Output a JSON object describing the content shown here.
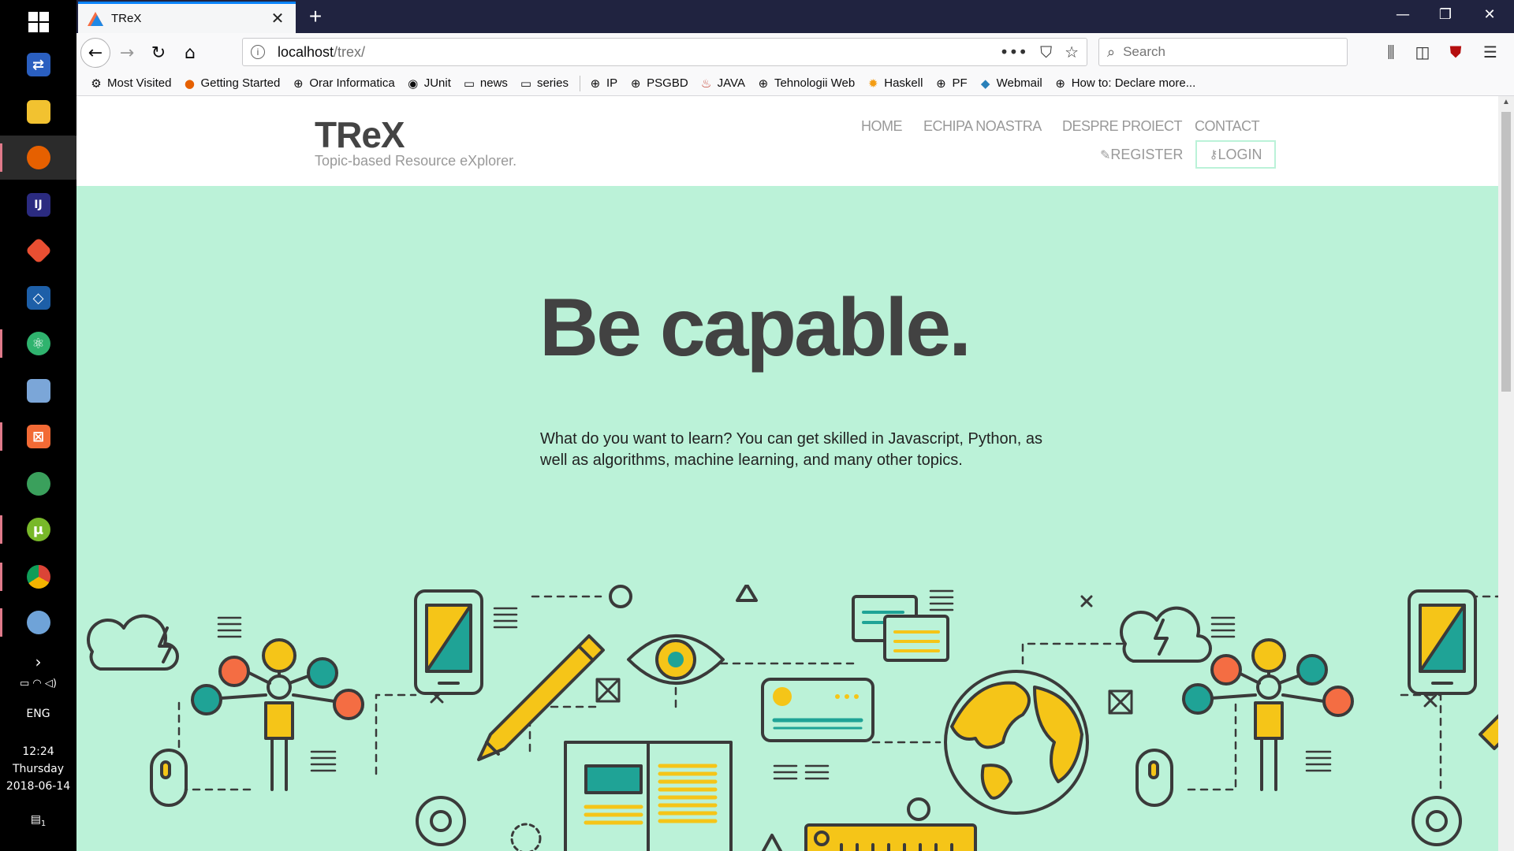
{
  "taskbar": {
    "tray": {
      "language": "ENG",
      "time": "12:24",
      "day": "Thursday",
      "date": "2018-06-14",
      "notification_count": "1"
    }
  },
  "browser": {
    "tab": {
      "title": "TReX"
    },
    "url": {
      "host": "localhost",
      "path": "/trex/"
    },
    "search": {
      "placeholder": "Search"
    },
    "bookmarks": [
      {
        "label": "Most Visited",
        "icon": "gear-icon"
      },
      {
        "label": "Getting Started",
        "icon": "firefox-icon"
      },
      {
        "label": "Orar Informatica",
        "icon": "globe-icon"
      },
      {
        "label": "JUnit",
        "icon": "github-icon"
      },
      {
        "label": "news",
        "icon": "folder-icon"
      },
      {
        "label": "series",
        "icon": "folder-icon"
      },
      {
        "label": "IP",
        "icon": "globe-icon"
      },
      {
        "label": "PSGBD",
        "icon": "globe-icon"
      },
      {
        "label": "JAVA",
        "icon": "java-icon"
      },
      {
        "label": "Tehnologii Web",
        "icon": "globe-icon"
      },
      {
        "label": "Haskell",
        "icon": "sun-icon"
      },
      {
        "label": "PF",
        "icon": "globe-icon"
      },
      {
        "label": "Webmail",
        "icon": "mail-icon"
      },
      {
        "label": "How to: Declare more...",
        "icon": "globe-icon"
      }
    ]
  },
  "site": {
    "logo": "TReX",
    "tagline": "Topic-based Resource eXplorer.",
    "menu": [
      "HOME",
      "ECHIPA NOASTRA",
      "DESPRE PROIECT",
      "CONTACT"
    ],
    "register": "REGISTER",
    "login": "LOGIN",
    "hero": {
      "title": "Be capable.",
      "text": "What do you want to learn? You can get skilled in Javascript, Python, as well as algorithms, machine learning, and many other topics."
    },
    "colors": {
      "accent": "#bbf2d8",
      "dark": "#424242",
      "yellow": "#f5c518",
      "teal": "#1fa396",
      "orange": "#f46d43"
    }
  }
}
